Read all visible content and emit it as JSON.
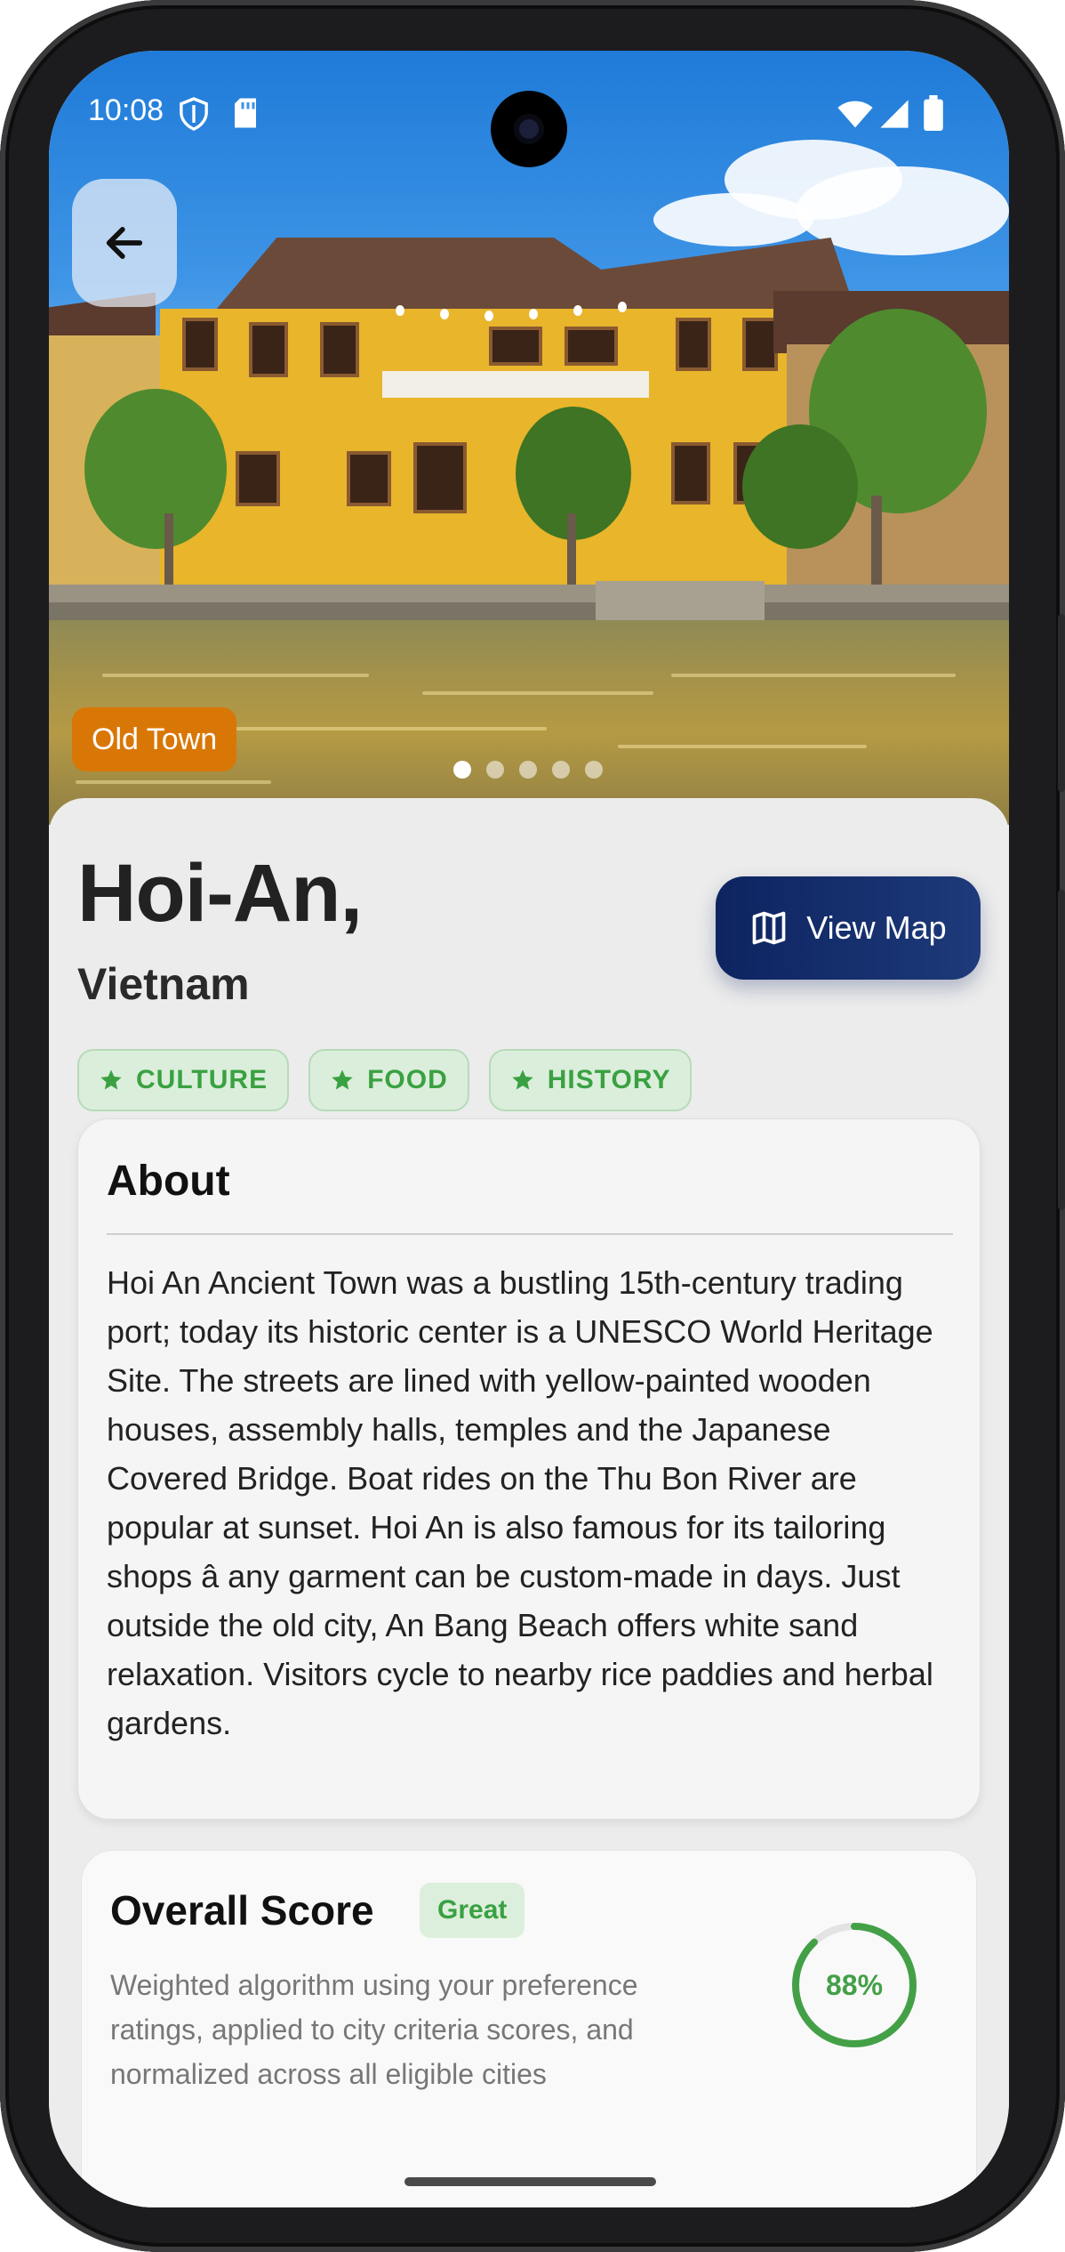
{
  "status_bar": {
    "time": "10:08",
    "left_icons": [
      "shield-icon",
      "sd-card-icon"
    ],
    "right_icons": [
      "wifi-icon",
      "signal-icon",
      "battery-icon"
    ]
  },
  "hero": {
    "category_chip": "Old Town",
    "carousel": {
      "count": 5,
      "active_index": 0
    }
  },
  "city": {
    "name": "Hoi-An,",
    "country": "Vietnam"
  },
  "view_map_label": "View Map",
  "tags": [
    "CULTURE",
    "FOOD",
    "HISTORY"
  ],
  "about": {
    "heading": "About",
    "text": "Hoi An Ancient Town was a bustling 15th-century trading port; today its historic center is a UNESCO World Heritage Site. The streets are lined with yellow-painted wooden houses, assembly halls, temples and the Japanese Covered Bridge. Boat rides on the Thu Bon River are popular at sunset. Hoi An is also famous for its tailoring shops â any garment can be custom-made in days. Just outside the old city, An Bang Beach offers white sand relaxation. Visitors cycle to nearby rice paddies and herbal gardens."
  },
  "overall_score": {
    "heading": "Overall Score",
    "badge": "Great",
    "description": "Weighted algorithm using your preference ratings, applied to city criteria scores, and normalized across all eligible cities",
    "percent_label": "88%",
    "percent_value": 88
  },
  "colors": {
    "accent_orange": "#d97706",
    "navy": "#0d2460",
    "green": "#43a047"
  }
}
